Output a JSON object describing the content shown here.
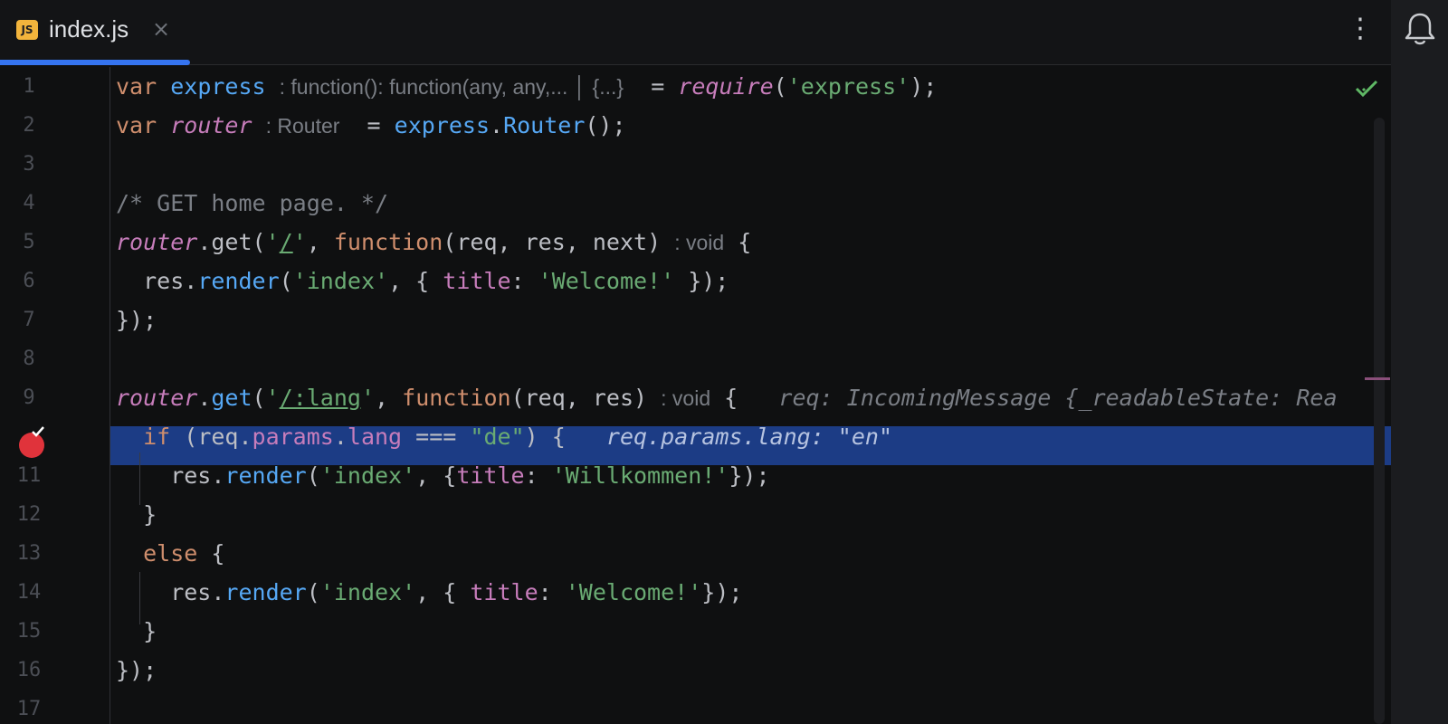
{
  "tab": {
    "icon_text": "JS",
    "label": "index.js",
    "close": "×"
  },
  "menu": {
    "kebab": "⋮"
  },
  "gutter": {
    "lines": [
      "1",
      "2",
      "3",
      "4",
      "5",
      "6",
      "7",
      "8",
      "9",
      "",
      "11",
      "12",
      "13",
      "14",
      "15",
      "16",
      "17"
    ]
  },
  "code": {
    "l1": {
      "kw": "var",
      "name": "express",
      "hint1": ": function(): function(any, any,...",
      "hint2": "{...}",
      "eq": " = ",
      "call": "require",
      "paren_open": "(",
      "str": "'express'",
      "tail": ");"
    },
    "l2": {
      "kw": "var",
      "name": "router",
      "hint": ": Router",
      "eq": " = ",
      "obj": "express",
      "dot": ".",
      "fn": "Router",
      "tail": "();"
    },
    "l4": {
      "comment": "/* GET home page. */"
    },
    "l5": {
      "obj": "router",
      "dot": ".get(",
      "q1": "'",
      "path": "/",
      "q2": "'",
      "sep": ", ",
      "kw": "function",
      "args": "(req, res, next)",
      "hint": ": void",
      "brace": " {"
    },
    "l6": {
      "indent": "  res.",
      "fn": "render",
      "open": "(",
      "str": "'index'",
      "sep": ", { ",
      "prop": "title",
      "colon": ": ",
      "val": "'Welcome!'",
      "tail": " });"
    },
    "l7": {
      "text": "});"
    },
    "l9": {
      "obj": "router",
      "dot": ".",
      "fn": "get",
      "open": "(",
      "q1": "'",
      "path": "/:lang",
      "q2": "'",
      "sep": ", ",
      "kw": "function",
      "args": "(req, res)",
      "hint": ": void",
      "brace": " {",
      "inline": "req: IncomingMessage {_readableState: Rea"
    },
    "l10": {
      "indent": "  ",
      "kw": "if",
      "open": " (req.",
      "p1": "params",
      "dot": ".",
      "p2": "lang",
      "op": " === ",
      "str": "\"de\"",
      "tail": ") {",
      "inline": "req.params.lang: \"en\""
    },
    "l11": {
      "indent": "    res.",
      "fn": "render",
      "open": "(",
      "str": "'index'",
      "sep": ", {",
      "prop": "title",
      "colon": ": ",
      "val": "'Willkommen!'",
      "tail": "});"
    },
    "l12": {
      "text": "  }"
    },
    "l13": {
      "indent": "  ",
      "kw": "else",
      "tail": " {"
    },
    "l14": {
      "indent": "    res.",
      "fn": "render",
      "open": "(",
      "str": "'index'",
      "sep": ", { ",
      "prop": "title",
      "colon": ": ",
      "val": "'Welcome!'",
      "tail": "});"
    },
    "l15": {
      "text": "  }"
    },
    "l16": {
      "text": "});"
    }
  },
  "colors": {
    "accent": "#3574f0",
    "highlight": "#1c3c85",
    "breakpoint": "#e0333b"
  }
}
